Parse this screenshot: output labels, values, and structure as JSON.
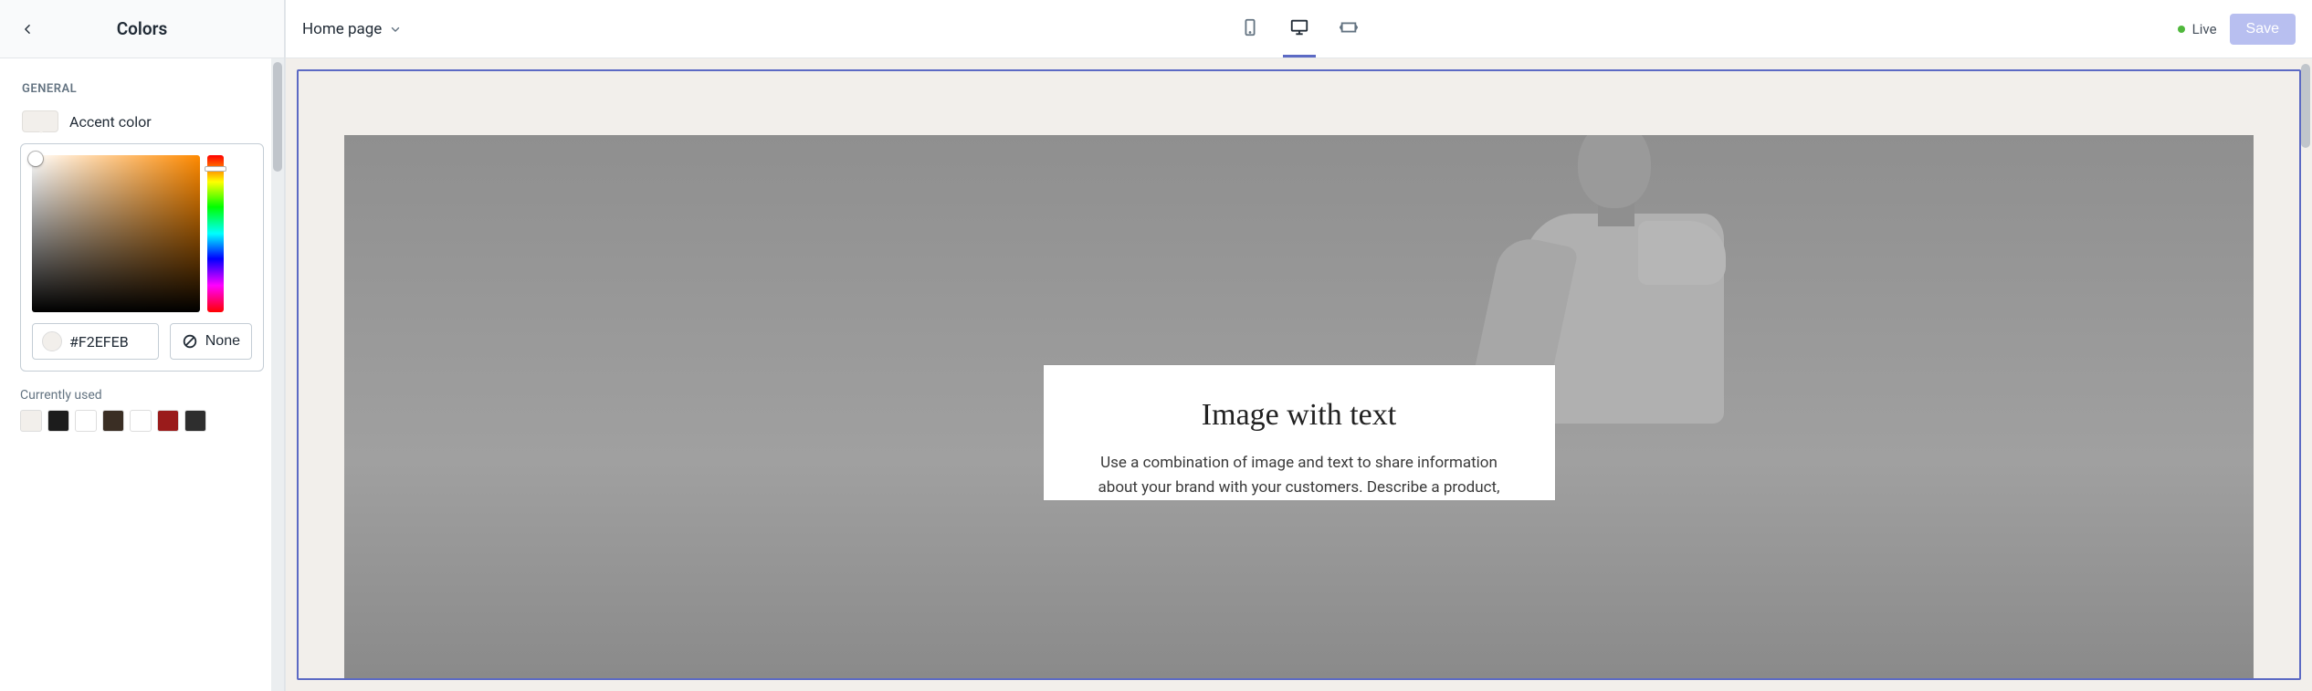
{
  "sidebar": {
    "title": "Colors",
    "section_label": "GENERAL",
    "accent_label": "Accent color",
    "hex_value": "#F2EFEB",
    "none_label": "None",
    "currently_used_label": "Currently used",
    "swatches": [
      "#f2efeb",
      "#1c1c1c",
      "#ffffff",
      "#3a2e24",
      "#ffffff",
      "#9a1b1b",
      "#2e2e2e"
    ]
  },
  "topbar": {
    "page_label": "Home page",
    "live_label": "Live",
    "save_label": "Save"
  },
  "preview": {
    "heading": "Image with text",
    "body": "Use a combination of image and text to share information about your brand with your customers. Describe a product,"
  },
  "colors": {
    "accent": "#5c6ac4",
    "live": "#50b83c"
  }
}
